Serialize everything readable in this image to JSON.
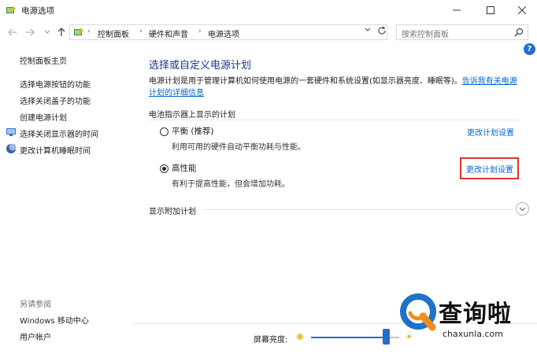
{
  "window": {
    "title": "电源选项",
    "controls": {
      "minimize": "—",
      "maximize": "☐",
      "close": "✕"
    }
  },
  "address_bar": {
    "breadcrumbs": [
      "控制面板",
      "硬件和声音",
      "电源选项"
    ],
    "search_placeholder": "搜索控制面板"
  },
  "sidebar": {
    "home": "控制面板主页",
    "links": [
      "选择电源按钮的功能",
      "选择关闭盖子的功能",
      "创建电源计划",
      "选择关闭显示器的时间",
      "更改计算机睡眠时间"
    ],
    "see_also_label": "另请参阅",
    "see_also": [
      "Windows 移动中心",
      "用户帐户"
    ]
  },
  "main": {
    "help": "?",
    "title": "选择或自定义电源计划",
    "description": "电源计划是用于管理计算机如何使用电源的一套硬件和系统设置(如显示器亮度、睡眠等)。",
    "description_link_1": "告诉我有关电源",
    "description_link_2": "计划的详细信息",
    "battery_plans_label": "电池指示器上显示的计划",
    "plans": [
      {
        "name": "平衡 (推荐)",
        "description": "利用可用的硬件自动平衡功耗与性能。",
        "change_link": "更改计划设置",
        "selected": false
      },
      {
        "name": "高性能",
        "description": "有利于提高性能，但会增加功耗。",
        "change_link": "更改计划设置",
        "selected": true
      }
    ],
    "show_additional": "显示附加计划"
  },
  "status_bar": {
    "brightness_label": "屏幕亮度:",
    "brightness_level": 0.85
  },
  "watermark": {
    "brand": "查询啦",
    "url": "chaxunla.com"
  },
  "colors": {
    "link": "#0066cc",
    "title": "#1e3287",
    "highlight": "#d9362b",
    "accent": "#1e6ed0"
  }
}
